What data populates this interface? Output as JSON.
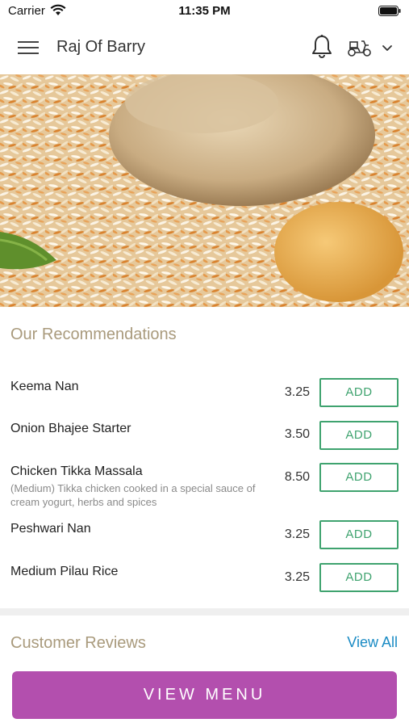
{
  "status_bar": {
    "carrier": "Carrier",
    "time": "11:35 PM"
  },
  "header": {
    "title": "Raj Of Barry"
  },
  "recommendations": {
    "title": "Our Recommendations",
    "items": [
      {
        "name": "Keema Nan",
        "description": "",
        "price": "3.25",
        "action": "ADD"
      },
      {
        "name": "Onion Bhajee Starter",
        "description": "",
        "price": "3.50",
        "action": "ADD"
      },
      {
        "name": "Chicken Tikka Massala",
        "description": "(Medium) Tikka chicken cooked in a special sauce of cream yogurt, herbs and spices",
        "price": "8.50",
        "action": "ADD"
      },
      {
        "name": "Peshwari Nan",
        "description": "",
        "price": "3.25",
        "action": "ADD"
      },
      {
        "name": "Medium Pilau Rice",
        "description": "",
        "price": "3.25",
        "action": "ADD"
      }
    ]
  },
  "reviews": {
    "title": "Customer Reviews",
    "view_all": "View All"
  },
  "footer": {
    "view_menu": "VIEW MENU"
  },
  "colors": {
    "accent": "#b34fae",
    "add_green": "#3fa36f",
    "section_title": "#a99a7c",
    "link_blue": "#1a8bc4"
  }
}
